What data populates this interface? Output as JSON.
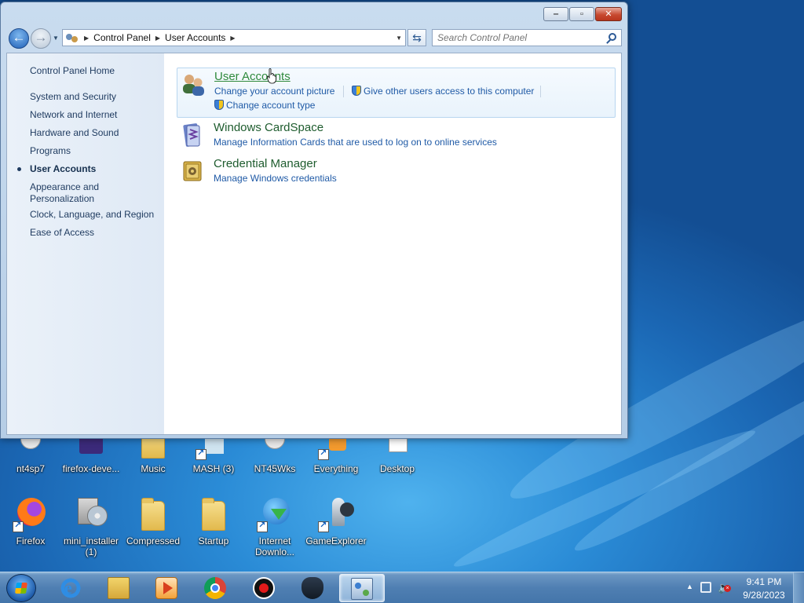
{
  "window": {
    "breadcrumb": [
      "Control Panel",
      "User Accounts"
    ],
    "search_placeholder": "Search Control Panel"
  },
  "sidebar": {
    "home": "Control Panel Home",
    "items": [
      "System and Security",
      "Network and Internet",
      "Hardware and Sound",
      "Programs",
      "User Accounts",
      "Appearance and\nPersonalization",
      "Clock, Language, and Region",
      "Ease of Access"
    ],
    "active_index": 4
  },
  "main": {
    "user_accounts": {
      "title": "User Accounts",
      "links": [
        "Change your account picture",
        "Give other users access to this computer",
        "Change account type"
      ]
    },
    "cardspace": {
      "title": "Windows CardSpace",
      "links": [
        "Manage Information Cards that are used to log on to online services"
      ]
    },
    "credential_manager": {
      "title": "Credential Manager",
      "links": [
        "Manage Windows credentials"
      ]
    }
  },
  "desktop": {
    "row1": [
      "nt4sp7",
      "firefox-deve...",
      "Music",
      "MASH (3)",
      "NT45Wks",
      "Everything",
      "Desktop"
    ],
    "row2": [
      "Firefox",
      "mini_installer\n(1)",
      "Compressed",
      "Startup",
      "Internet\nDownlo...",
      "GameExplorer"
    ]
  },
  "taskbar": {
    "time": "9:41 PM",
    "date": "9/28/2023",
    "pinned_icons": [
      "internet-explorer-icon",
      "file-explorer-icon",
      "media-player-icon",
      "chrome-icon",
      "record-icon",
      "game-icon",
      "control-panel-icon"
    ]
  },
  "colors": {
    "link_blue": "#1f5aa6",
    "title_green": "#1e5c2e",
    "hover_green": "#2f8a3c"
  }
}
